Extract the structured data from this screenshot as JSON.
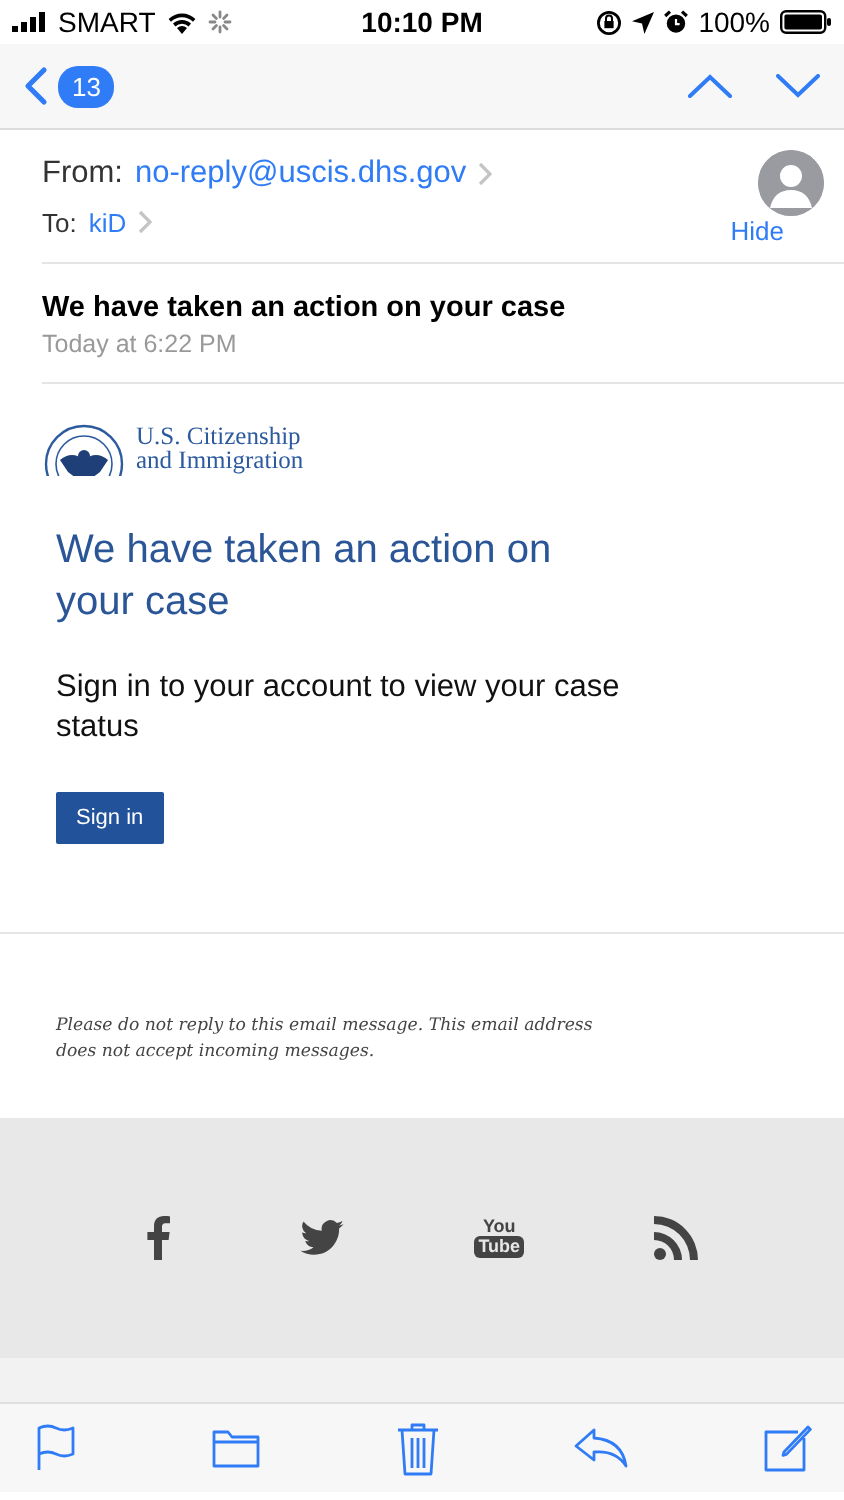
{
  "status_bar": {
    "carrier": "SMART",
    "time": "10:10 PM",
    "battery": "100%"
  },
  "nav_bar": {
    "unread_count": "13"
  },
  "header": {
    "from_label": "From:",
    "from": "no-reply@uscis.dhs.gov",
    "to_label": "To:",
    "to": "kiD",
    "hide": "Hide",
    "subject": "We have taken an action on your case",
    "date": "Today at 6:22 PM"
  },
  "body": {
    "logo_lines": [
      "U.S. Citizenship",
      "and Immigration"
    ],
    "heading": "We have taken an action on your case",
    "text": "Sign in to your account to view your case status",
    "button": "Sign in",
    "disclaimer": "Please do not reply to this email message. This email address does not accept incoming messages.",
    "social": [
      {
        "kind": "facebook"
      },
      {
        "kind": "twitter"
      },
      {
        "kind": "youtube",
        "lines": [
          "You",
          "Tube"
        ]
      },
      {
        "kind": "rss"
      }
    ]
  },
  "toolbar": [
    {
      "kind": "flag"
    },
    {
      "kind": "folder"
    },
    {
      "kind": "trash"
    },
    {
      "kind": "reply"
    },
    {
      "kind": "compose"
    }
  ]
}
